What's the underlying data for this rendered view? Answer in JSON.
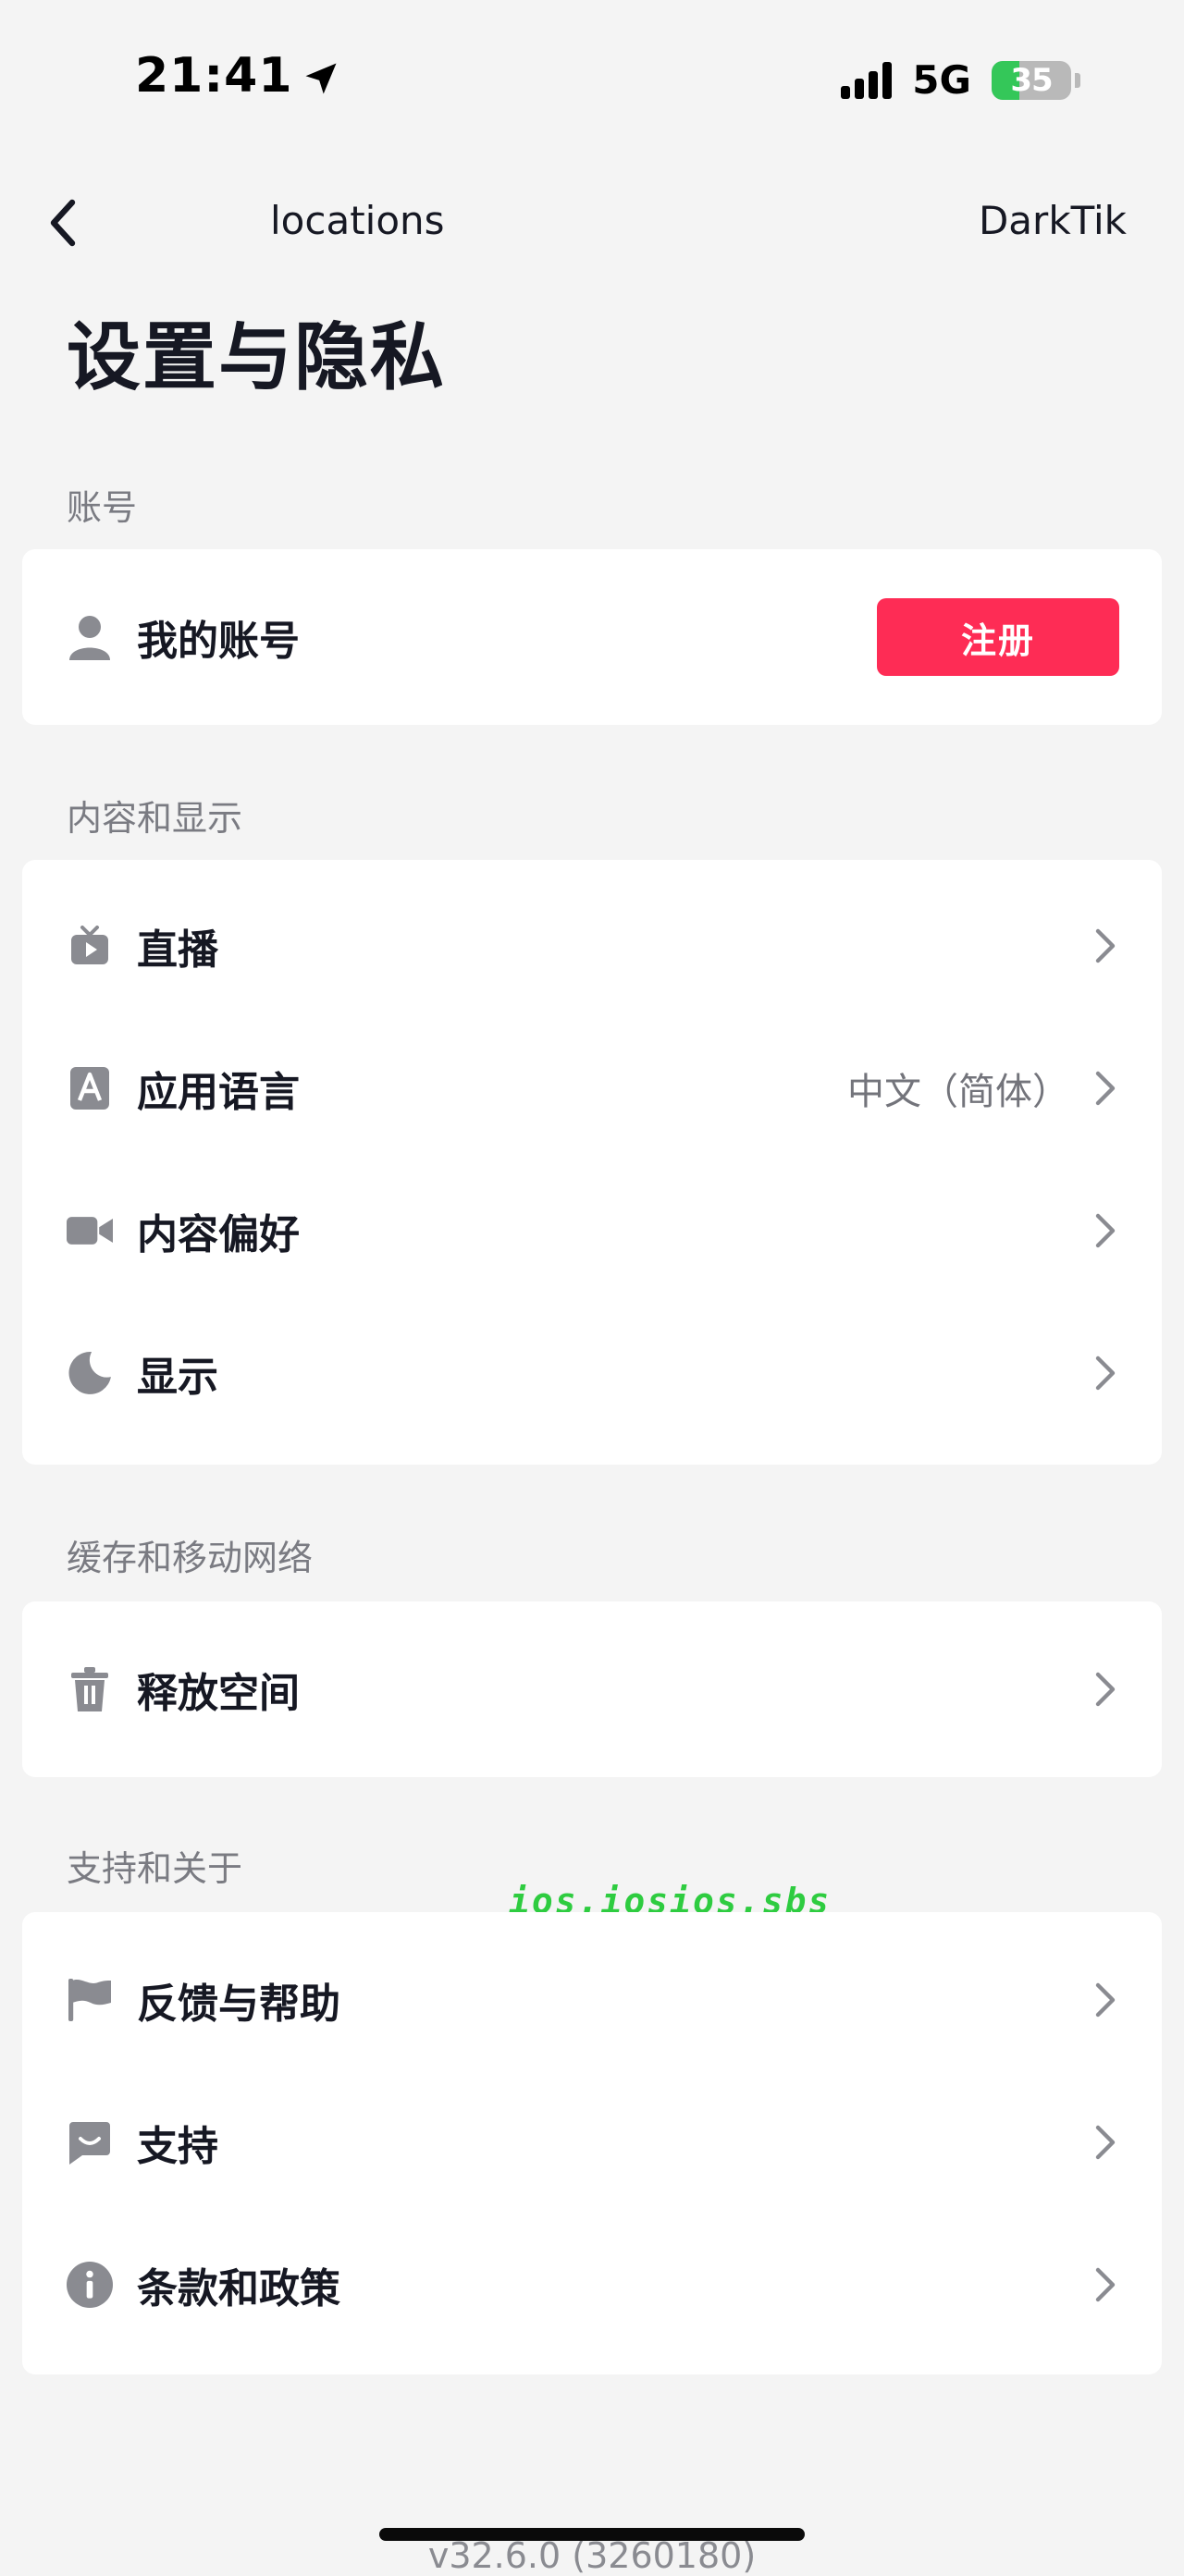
{
  "status_bar": {
    "time": "21:41",
    "network": "5G",
    "battery": "35",
    "battery_level": 0.35,
    "battery_color": "#34c759"
  },
  "nav": {
    "back_icon": "chevron-left-icon",
    "center_text": "locations",
    "right_text": "DarkTik"
  },
  "page": {
    "title": "设置与隐私"
  },
  "sections": {
    "account": {
      "title": "账号",
      "items": [
        {
          "label": "我的账号",
          "icon": "person-icon",
          "button": "注册"
        }
      ]
    },
    "content": {
      "title": "内容和显示",
      "items": [
        {
          "label": "直播",
          "icon": "tv-icon"
        },
        {
          "label": "应用语言",
          "icon": "language-icon",
          "value": "中文（简体）"
        },
        {
          "label": "内容偏好",
          "icon": "video-camera-icon"
        },
        {
          "label": "显示",
          "icon": "moon-icon"
        }
      ]
    },
    "cache": {
      "title": "缓存和移动网络",
      "items": [
        {
          "label": "释放空间",
          "icon": "trash-icon"
        }
      ]
    },
    "support": {
      "title": "支持和关于",
      "items": [
        {
          "label": "反馈与帮助",
          "icon": "flag-icon"
        },
        {
          "label": "支持",
          "icon": "chat-smile-icon"
        },
        {
          "label": "条款和政策",
          "icon": "info-icon"
        }
      ]
    }
  },
  "watermark": "ios.iosios.sbs",
  "version": "v32.6.0 (3260180)",
  "colors": {
    "accent": "#fe2c55",
    "background": "#f4f4f4",
    "watermark": "#2ecc40",
    "icon_gray": "#8a8b91"
  }
}
